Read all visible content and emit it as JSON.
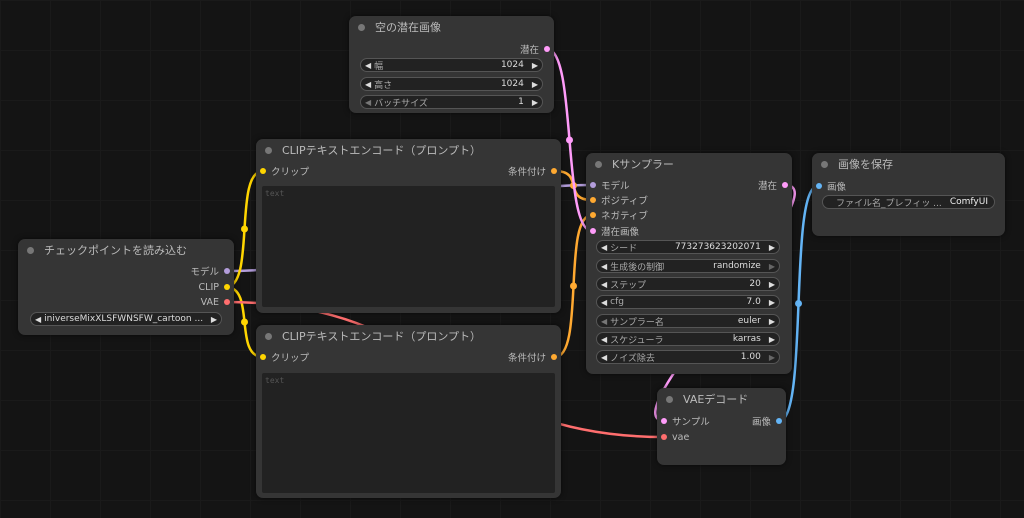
{
  "colors": {
    "model": "#b39ddb",
    "clip": "#ffd500",
    "vae": "#ff6e6e",
    "conditioning": "#ffa931",
    "latent": "#ff9cf9",
    "image": "#64b5f6"
  },
  "empty_latent": {
    "title": "空の潜在画像",
    "output": "潜在",
    "widgets": [
      {
        "label": "幅",
        "value": "1024"
      },
      {
        "label": "高さ",
        "value": "1024"
      },
      {
        "label": "バッチサイズ",
        "value": "1"
      }
    ]
  },
  "clip_pos": {
    "title": "CLIPテキストエンコード（プロンプト）",
    "input": "クリップ",
    "output": "条件付け",
    "placeholder": "text"
  },
  "clip_neg": {
    "title": "CLIPテキストエンコード（プロンプト）",
    "input": "クリップ",
    "output": "条件付け",
    "placeholder": "text"
  },
  "checkpoint": {
    "title": "チェックポイントを読み込む",
    "outputs": [
      "モデル",
      "CLIP",
      "VAE"
    ],
    "ckpt_name": "iniverseMixXLSFWNSFW_cartoon ..."
  },
  "ksampler": {
    "title": "Kサンプラー",
    "inputs": [
      "モデル",
      "ポジティブ",
      "ネガティブ",
      "潜在画像"
    ],
    "output": "潜在",
    "widgets": [
      {
        "label": "シード",
        "value": "773273623202071"
      },
      {
        "label": "生成後の制御",
        "value": "randomize"
      },
      {
        "label": "ステップ",
        "value": "20"
      },
      {
        "label": "cfg",
        "value": "7.0"
      },
      {
        "label": "サンプラー名",
        "value": "euler"
      },
      {
        "label": "スケジューラ",
        "value": "karras"
      },
      {
        "label": "ノイズ除去",
        "value": "1.00"
      }
    ]
  },
  "save": {
    "title": "画像を保存",
    "input": "画像",
    "widget": {
      "label": "ファイル名_プレフィッ ...",
      "value": "ComfyUI"
    }
  },
  "vae_decode": {
    "title": "VAEデコード",
    "inputs": [
      "サンプル",
      "vae"
    ],
    "output": "画像"
  }
}
